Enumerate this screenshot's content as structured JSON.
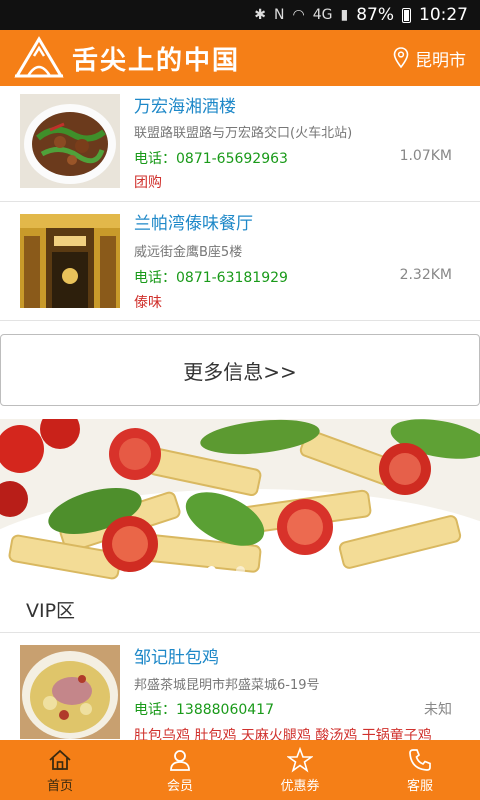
{
  "status_bar": {
    "battery": "87%",
    "time": "10:27",
    "network": "4G"
  },
  "header": {
    "logo_text": "舌尖上的中国",
    "location": "昆明市"
  },
  "restaurants": [
    {
      "name": "万宏海湘酒楼",
      "address": "联盟路联盟路与万宏路交口(火车北站)",
      "phone": "电话：0871-65692963",
      "distance": "1.07KM",
      "tag": "团购"
    },
    {
      "name": "兰帕湾傣味餐厅",
      "address": "威远街金鹰B座5楼",
      "phone": "电话：0871-63181929",
      "distance": "2.32KM",
      "tag": "傣味"
    }
  ],
  "more_button": "更多信息>>",
  "banner": {
    "slides": 3,
    "active_index": 0
  },
  "vip": {
    "title": "VIP区",
    "item": {
      "name": "邹记肚包鸡",
      "address": "邦盛茶城昆明市邦盛菜城6-19号",
      "phone": "电话：13888060417",
      "distance": "未知",
      "tag": "肚包乌鸡 肚包鸡 天麻火腿鸡 酸汤鸡 干锅童子鸡"
    }
  },
  "tabs": [
    {
      "label": "首页",
      "icon": "home-icon",
      "active": true
    },
    {
      "label": "会员",
      "icon": "user-icon",
      "active": false
    },
    {
      "label": "优惠券",
      "icon": "star-icon",
      "active": false
    },
    {
      "label": "客服",
      "icon": "phone-icon",
      "active": false
    }
  ],
  "colors": {
    "brand": "#f57f17",
    "link": "#1e88c8",
    "phone": "#1a9a1a",
    "tag": "#d0312d"
  }
}
